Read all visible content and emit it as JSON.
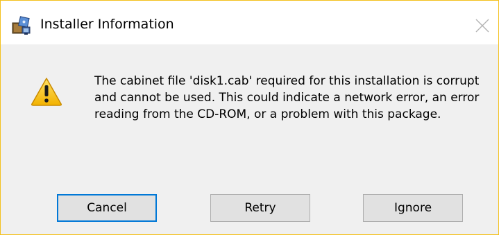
{
  "window": {
    "title": "Installer Information",
    "app_icon": "installer-package-icon",
    "close_icon": "close-icon",
    "border_color": "#f4c01b"
  },
  "message": {
    "icon": "warning-icon",
    "text": "The cabinet file 'disk1.cab' required for this installation is corrupt and cannot be used. This could indicate a network error, an error reading from the CD-ROM, or a problem with this package."
  },
  "buttons": {
    "cancel": "Cancel",
    "retry": "Retry",
    "ignore": "Ignore",
    "default_focus_color": "#0078d7"
  }
}
